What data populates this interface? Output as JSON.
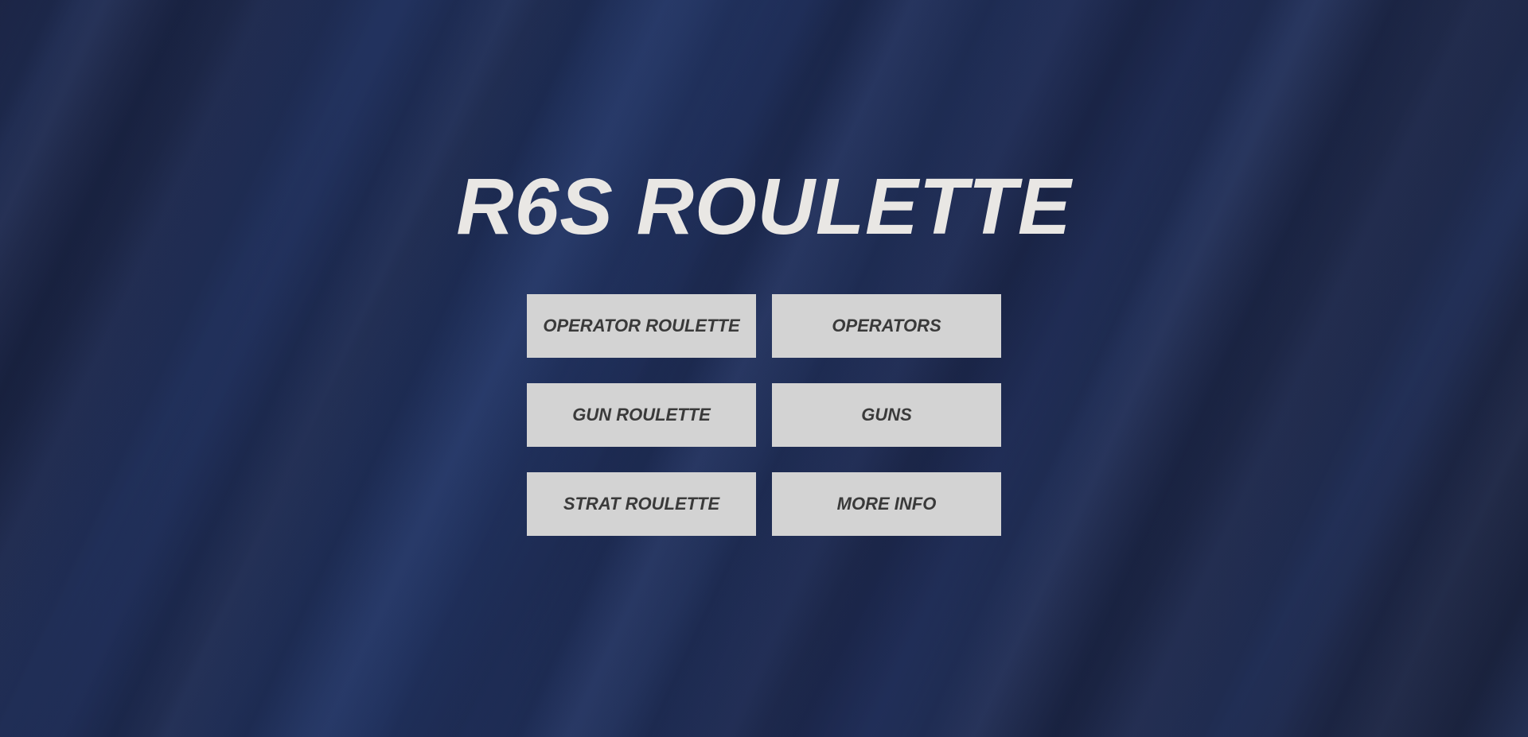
{
  "title": "R6S ROULETTE",
  "menu": {
    "operator_roulette": "OPERATOR ROULETTE",
    "operators": "OPERATORS",
    "gun_roulette": "GUN ROULETTE",
    "guns": "GUNS",
    "strat_roulette": "STRAT ROULETTE",
    "more_info": "MORE INFO"
  },
  "colors": {
    "background": "#1f2b50",
    "title": "#e9e7e4",
    "button_bg": "#d3d3d3",
    "button_text": "#3a3a3a"
  }
}
